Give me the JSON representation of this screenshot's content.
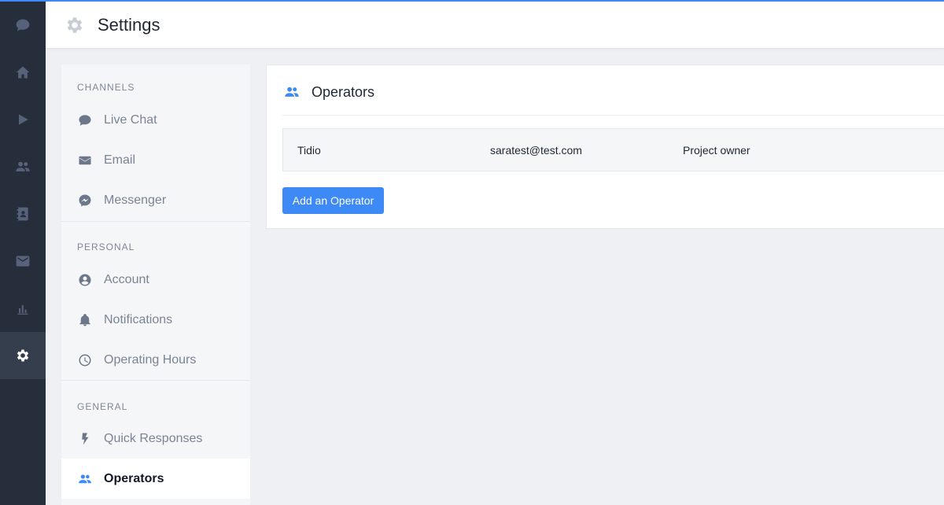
{
  "header": {
    "title": "Settings",
    "icon": "gear-icon"
  },
  "rail": [
    {
      "name": "chat-icon",
      "active": false
    },
    {
      "name": "home-icon",
      "active": false
    },
    {
      "name": "play-icon",
      "active": false
    },
    {
      "name": "visitors-icon",
      "active": false
    },
    {
      "name": "contacts-icon",
      "active": false
    },
    {
      "name": "mailbox-icon",
      "active": false
    },
    {
      "name": "analytics-icon",
      "active": false
    },
    {
      "name": "settings-icon",
      "active": true
    }
  ],
  "nav": {
    "sections": [
      {
        "title": "CHANNELS",
        "items": [
          {
            "label": "Live Chat",
            "icon": "chat-bubble-icon"
          },
          {
            "label": "Email",
            "icon": "envelope-icon"
          },
          {
            "label": "Messenger",
            "icon": "messenger-icon"
          }
        ]
      },
      {
        "title": "PERSONAL",
        "items": [
          {
            "label": "Account",
            "icon": "user-circle-icon"
          },
          {
            "label": "Notifications",
            "icon": "bell-icon"
          },
          {
            "label": "Operating Hours",
            "icon": "clock-icon"
          }
        ]
      },
      {
        "title": "GENERAL",
        "items": [
          {
            "label": "Quick Responses",
            "icon": "lightning-icon"
          },
          {
            "label": "Operators",
            "icon": "people-icon",
            "active": true
          }
        ]
      }
    ]
  },
  "main": {
    "title": "Operators",
    "icon": "people-icon",
    "operators": [
      {
        "name": "Tidio",
        "email": "saratest@test.com",
        "role": "Project owner"
      }
    ],
    "add_button": "Add an Operator"
  },
  "colors": {
    "accent": "#3d8af7",
    "rail_bg": "#262e3b",
    "page_bg": "#eef0f4"
  }
}
